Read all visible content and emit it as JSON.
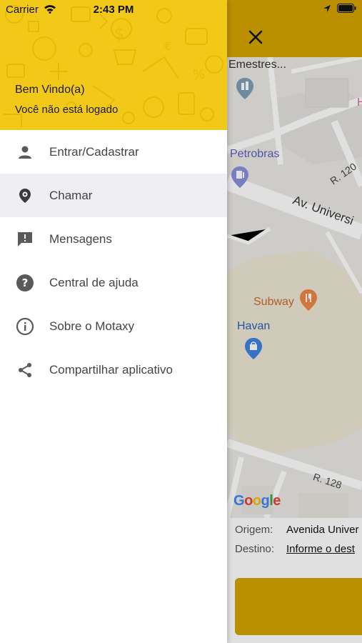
{
  "status_bar": {
    "carrier": "Carrier",
    "time": "2:43 PM"
  },
  "drawer": {
    "welcome": "Bem Vindo(a)",
    "login_status": "Você não está logado",
    "items": [
      {
        "label": "Entrar/Cadastrar",
        "icon": "person-icon",
        "active": false
      },
      {
        "label": "Chamar",
        "icon": "location-pin-icon",
        "active": true
      },
      {
        "label": "Mensagens",
        "icon": "message-alert-icon",
        "active": false
      },
      {
        "label": "Central de ajuda",
        "icon": "help-icon",
        "active": false
      },
      {
        "label": "Sobre o Motaxy",
        "icon": "info-icon",
        "active": false
      },
      {
        "label": "Compartilhar aplicativo",
        "icon": "share-icon",
        "active": false
      }
    ]
  },
  "map": {
    "labels": {
      "emestres": "Emestres...",
      "petrobras": "Petrobras",
      "street_r120": "R. 120",
      "avenue": "Av. Universi",
      "subway": "Subway",
      "havan": "Havan",
      "street_r128": "R. 128",
      "partial_h": "H"
    },
    "google": "Google"
  },
  "route": {
    "origin_label": "Origem:",
    "origin_value": "Avenida Univer",
    "destination_label": "Destino:",
    "destination_value": "Informe o dest"
  },
  "colors": {
    "brand_yellow": "#f2c919",
    "header_dark_yellow": "#d4a300",
    "active_item_bg": "#efeff3"
  }
}
